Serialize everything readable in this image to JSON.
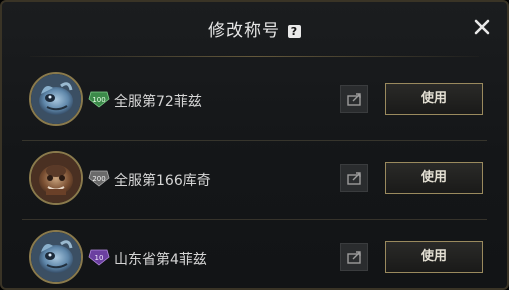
{
  "dialog": {
    "title": "修改称号"
  },
  "titles": [
    {
      "badge_text": "100",
      "title": "全服第72菲兹",
      "badge_color": "#3c8a4a",
      "hero": "fizz",
      "use_label": "使用"
    },
    {
      "badge_text": "200",
      "title": "全服第166库奇",
      "badge_color": "#6a6a6a",
      "hero": "corki",
      "use_label": "使用"
    },
    {
      "badge_text": "10",
      "title": "山东省第4菲兹",
      "badge_color": "#6b3fa0",
      "hero": "fizz",
      "use_label": "使用"
    }
  ],
  "colors": {
    "accent_border": "#9a8a5e",
    "panel_bg": "#141618"
  }
}
